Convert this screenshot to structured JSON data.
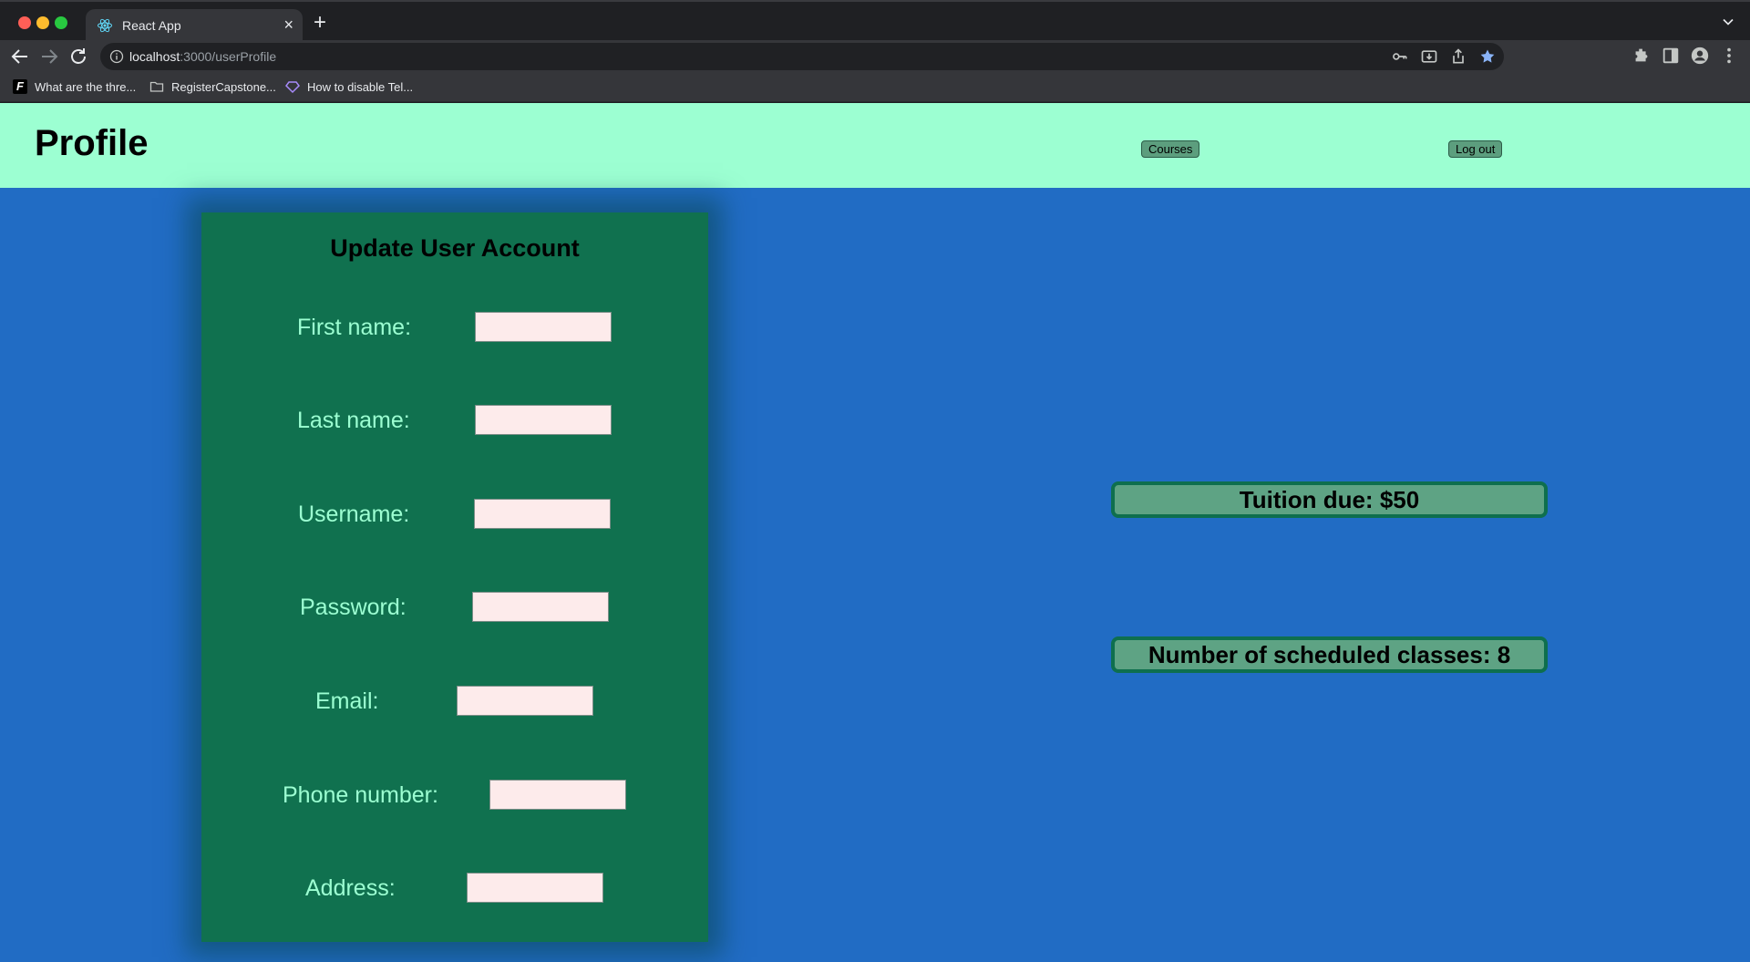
{
  "browser": {
    "tab_title": "React App",
    "tab_close": "×",
    "new_tab": "+",
    "url_host": "localhost",
    "url_path": ":3000/userProfile",
    "bookmarks": [
      {
        "label": "What are the thre...",
        "icon": "f-logo-icon"
      },
      {
        "label": "RegisterCapstone...",
        "icon": "folder-icon"
      },
      {
        "label": "How to disable Tel...",
        "icon": "diamond-icon"
      }
    ],
    "bookmark_f_glyph": "F"
  },
  "header": {
    "title": "Profile",
    "courses_label": "Courses",
    "logout_label": "Log out"
  },
  "form": {
    "title": "Update User Account",
    "fields": [
      {
        "label": "First name:",
        "value": ""
      },
      {
        "label": "Last name:",
        "value": ""
      },
      {
        "label": "Username:",
        "value": ""
      },
      {
        "label": "Password:",
        "value": ""
      },
      {
        "label": "Email:",
        "value": ""
      },
      {
        "label": "Phone number:",
        "value": ""
      },
      {
        "label": "Address:",
        "value": ""
      }
    ]
  },
  "stats": {
    "tuition": "Tuition due: $50",
    "classes": "Number of scheduled classes: 8"
  },
  "colors": {
    "header_bg": "#9cffd2",
    "page_bg": "#216cc4",
    "card_bg": "#10714f",
    "label_color": "#9cffd2",
    "input_bg": "#fdebeb",
    "stat_bg": "#5ea384",
    "stat_border": "#0e6f4e"
  }
}
